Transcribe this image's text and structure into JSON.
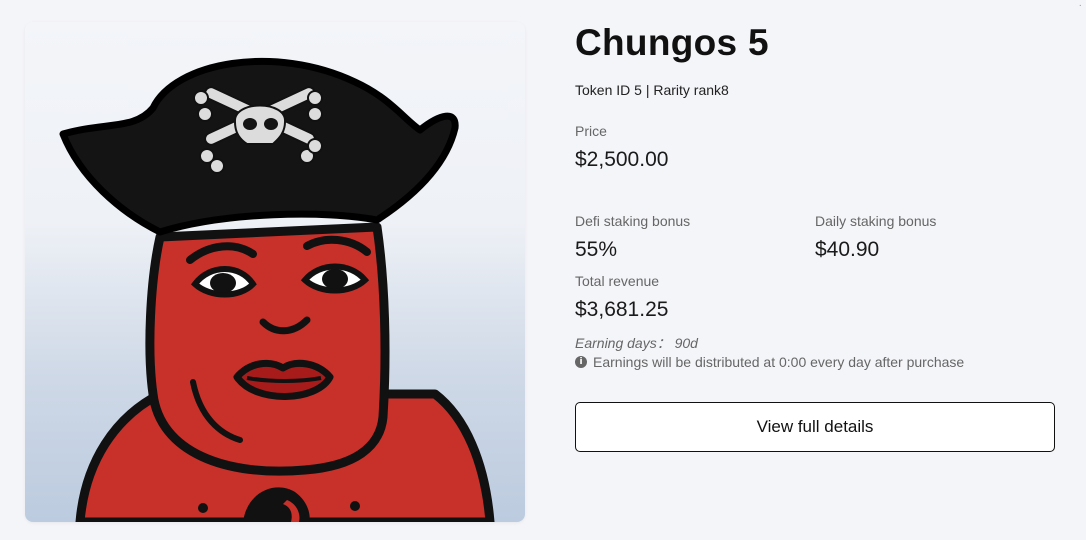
{
  "nft": {
    "title": "Chungos 5",
    "image_alt": "Chungos 5 pirate character artwork",
    "token_line": "Token ID 5 | Rarity rank8"
  },
  "price": {
    "label": "Price",
    "value": "$2,500.00"
  },
  "staking": {
    "defi_label": "Defi staking bonus",
    "defi_value": "55%",
    "daily_label": "Daily staking bonus",
    "daily_value": "$40.90"
  },
  "revenue": {
    "label": "Total revenue",
    "value": "$3,681.25"
  },
  "earning_days": "Earning days： 90d",
  "notice": {
    "icon": "info-icon",
    "text": "Earnings will be distributed at 0:00 every day after purchase"
  },
  "actions": {
    "details_label": "View full details"
  },
  "colors": {
    "background": "#f4f5f9",
    "skin": "#c8302a",
    "hat": "#141414",
    "button_border": "#111111"
  }
}
